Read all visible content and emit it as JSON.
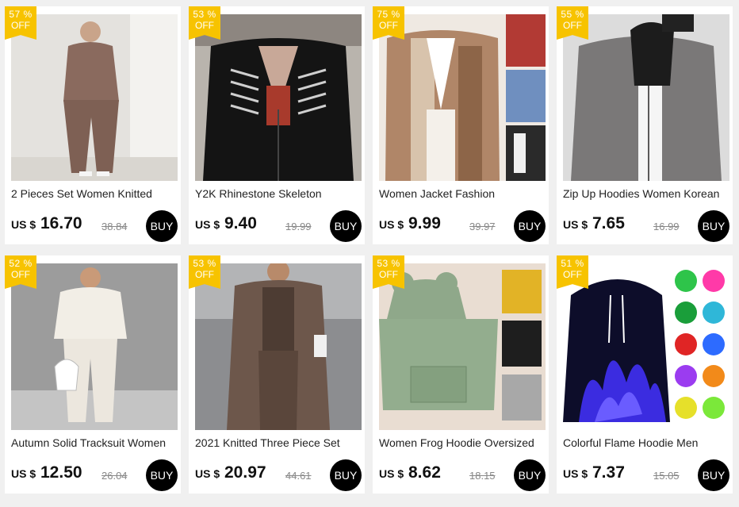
{
  "products": [
    {
      "title": "2 Pieces Set Women Knitted",
      "discount": "57 %",
      "off_label": "OFF",
      "currency": "US $",
      "price": "16.70",
      "original_price": "38.84",
      "buy_label": "BUY",
      "image": "woman-brown-knit-set"
    },
    {
      "title": "Y2K Rhinestone Skeleton",
      "discount": "53 %",
      "off_label": "OFF",
      "currency": "US $",
      "price": "9.40",
      "original_price": "19.99",
      "buy_label": "BUY",
      "image": "black-skeleton-hoodie"
    },
    {
      "title": "Women Jacket Fashion",
      "discount": "75 %",
      "off_label": "OFF",
      "currency": "US $",
      "price": "9.99",
      "original_price": "39.97",
      "buy_label": "BUY",
      "image": "patchwork-fleece-jacket"
    },
    {
      "title": "Zip Up Hoodies Women Korean",
      "discount": "55 %",
      "off_label": "OFF",
      "currency": "US $",
      "price": "7.65",
      "original_price": "16.99",
      "buy_label": "BUY",
      "image": "grey-zip-hoodie"
    },
    {
      "title": "Autumn Solid Tracksuit Women",
      "discount": "52 %",
      "off_label": "OFF",
      "currency": "US $",
      "price": "12.50",
      "original_price": "26.04",
      "buy_label": "BUY",
      "image": "white-tracksuit"
    },
    {
      "title": "2021 Knitted Three Piece Set",
      "discount": "53 %",
      "off_label": "OFF",
      "currency": "US $",
      "price": "20.97",
      "original_price": "44.61",
      "buy_label": "BUY",
      "image": "brown-cardigan-set"
    },
    {
      "title": "Women Frog Hoodie Oversized",
      "discount": "53 %",
      "off_label": "OFF",
      "currency": "US $",
      "price": "8.62",
      "original_price": "18.15",
      "buy_label": "BUY",
      "image": "green-frog-hoodie"
    },
    {
      "title": "Colorful Flame Hoodie Men",
      "discount": "51 %",
      "off_label": "OFF",
      "currency": "US $",
      "price": "7.37",
      "original_price": "15.05",
      "buy_label": "BUY",
      "image": "blue-flame-hoodie"
    }
  ],
  "colors": {
    "badge": "#f7c300",
    "buy_button": "#000000",
    "background": "#f0f0f0"
  }
}
